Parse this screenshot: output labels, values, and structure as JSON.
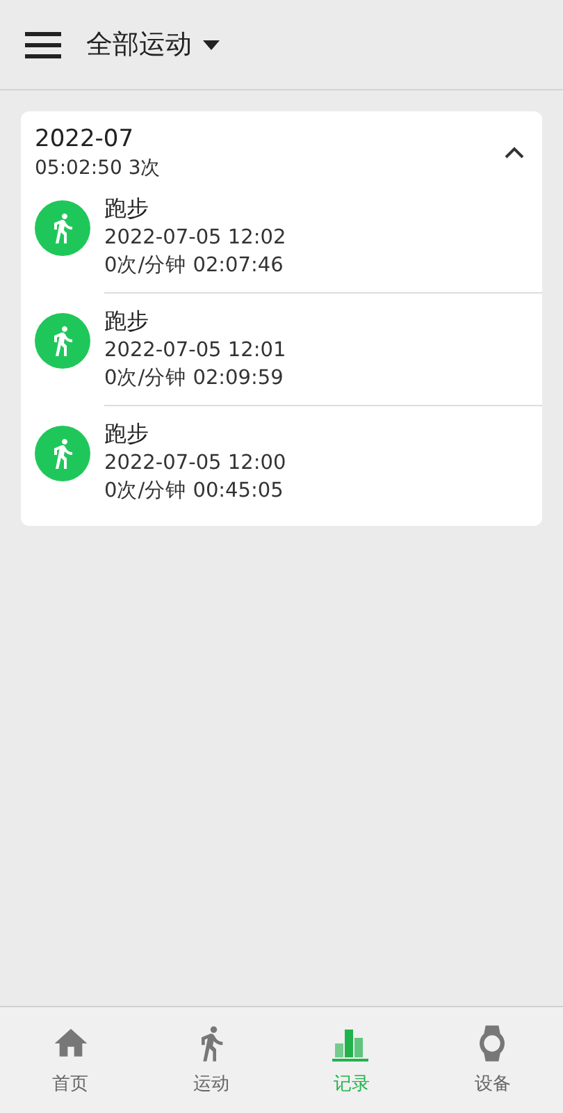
{
  "header": {
    "title": "全部运动"
  },
  "group": {
    "month": "2022-07",
    "summary": "05:02:50 3次",
    "expanded": true,
    "records": [
      {
        "name": "跑步",
        "time": "2022-07-05 12:02",
        "stats": "0次/分钟 02:07:46"
      },
      {
        "name": "跑步",
        "time": "2022-07-05 12:01",
        "stats": "0次/分钟 02:09:59"
      },
      {
        "name": "跑步",
        "time": "2022-07-05 12:00",
        "stats": "0次/分钟 00:45:05"
      }
    ]
  },
  "nav": [
    {
      "kind": "home",
      "label": "首页",
      "selected": false
    },
    {
      "kind": "sport",
      "label": "运动",
      "selected": false
    },
    {
      "kind": "records",
      "label": "记录",
      "selected": true
    },
    {
      "kind": "device",
      "label": "设备",
      "selected": false
    }
  ]
}
